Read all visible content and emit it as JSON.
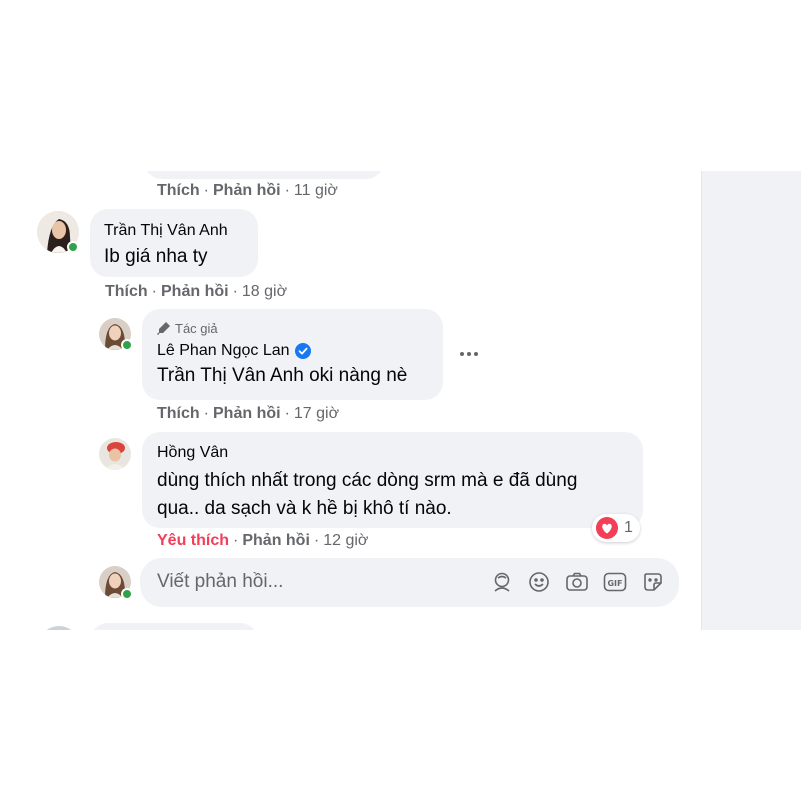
{
  "comments": {
    "top_partial": {
      "like": "Thích",
      "reply": "Phản hồi",
      "time": "11 giờ"
    },
    "c1": {
      "author": "Trần Thị Vân Anh",
      "text": "Ib giá nha ty",
      "like": "Thích",
      "reply": "Phản hồi",
      "time": "18 giờ"
    },
    "r1": {
      "badge": "Tác giả",
      "author": "Lê Phan Ngọc Lan",
      "mention": "Trần Thị Vân Anh",
      "text": " oki nàng nè",
      "like": "Thích",
      "reply": "Phản hồi",
      "time": "17 giờ"
    },
    "r2": {
      "author": "Hồng Vân",
      "line1": "dùng thích nhất trong các dòng srm mà e đã dùng",
      "line2": "qua.. da sạch và k hề bị khô tí nào.",
      "like": "Yêu thích",
      "reply": "Phản hồi",
      "time": "12 giờ",
      "reaction_count": "1"
    }
  },
  "reply_box": {
    "placeholder": "Viết phản hồi..."
  },
  "colors": {
    "love_red": "#f33e58",
    "verified_blue": "#1877f2",
    "online_green": "#31a24c",
    "muted": "#65676b"
  }
}
